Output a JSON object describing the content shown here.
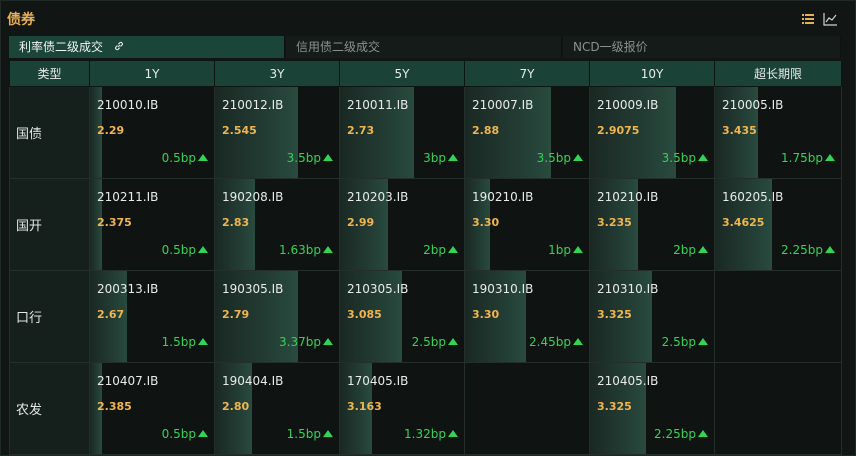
{
  "panel": {
    "title": "债券"
  },
  "tabs": [
    {
      "label": "利率债二级成交",
      "active": true,
      "icon": "link-icon"
    },
    {
      "label": "信用债二级成交",
      "active": false
    },
    {
      "label": "NCD一级报价",
      "active": false
    }
  ],
  "table": {
    "columns": [
      "类型",
      "1Y",
      "3Y",
      "5Y",
      "7Y",
      "10Y",
      "超长期限"
    ],
    "rows": [
      {
        "type": "国债",
        "cells": [
          {
            "code": "210010.IB",
            "price": "2.29",
            "change": "0.5bp",
            "fill": 0.1
          },
          {
            "code": "210012.IB",
            "price": "2.545",
            "change": "3.5bp",
            "fill": 0.67
          },
          {
            "code": "210011.IB",
            "price": "2.73",
            "change": "3bp",
            "fill": 0.6
          },
          {
            "code": "210007.IB",
            "price": "2.88",
            "change": "3.5bp",
            "fill": 0.69
          },
          {
            "code": "210009.IB",
            "price": "2.9075",
            "change": "3.5bp",
            "fill": 0.69
          },
          {
            "code": "210005.IB",
            "price": "3.435",
            "change": "1.75bp",
            "fill": 0.34
          }
        ]
      },
      {
        "type": "国开",
        "cells": [
          {
            "code": "210211.IB",
            "price": "2.375",
            "change": "0.5bp",
            "fill": 0.1
          },
          {
            "code": "190208.IB",
            "price": "2.83",
            "change": "1.63bp",
            "fill": 0.32
          },
          {
            "code": "210203.IB",
            "price": "2.99",
            "change": "2bp",
            "fill": 0.39
          },
          {
            "code": "190210.IB",
            "price": "3.30",
            "change": "1bp",
            "fill": 0.2
          },
          {
            "code": "210210.IB",
            "price": "3.235",
            "change": "2bp",
            "fill": 0.39
          },
          {
            "code": "160205.IB",
            "price": "3.4625",
            "change": "2.25bp",
            "fill": 0.45
          }
        ]
      },
      {
        "type": "口行",
        "cells": [
          {
            "code": "200313.IB",
            "price": "2.67",
            "change": "1.5bp",
            "fill": 0.3
          },
          {
            "code": "190305.IB",
            "price": "2.79",
            "change": "3.37bp",
            "fill": 0.67
          },
          {
            "code": "210305.IB",
            "price": "3.085",
            "change": "2.5bp",
            "fill": 0.5
          },
          {
            "code": "190310.IB",
            "price": "3.30",
            "change": "2.45bp",
            "fill": 0.49
          },
          {
            "code": "210310.IB",
            "price": "3.325",
            "change": "2.5bp",
            "fill": 0.5
          },
          null
        ]
      },
      {
        "type": "农发",
        "cells": [
          {
            "code": "210407.IB",
            "price": "2.385",
            "change": "0.5bp",
            "fill": 0.1
          },
          {
            "code": "190404.IB",
            "price": "2.80",
            "change": "1.5bp",
            "fill": 0.3
          },
          {
            "code": "170405.IB",
            "price": "3.163",
            "change": "1.32bp",
            "fill": 0.26
          },
          null,
          {
            "code": "210405.IB",
            "price": "3.325",
            "change": "2.25bp",
            "fill": 0.45
          },
          null
        ]
      }
    ]
  },
  "icons": {
    "header_left": "list-icon",
    "header_right": "line-chart-icon"
  }
}
